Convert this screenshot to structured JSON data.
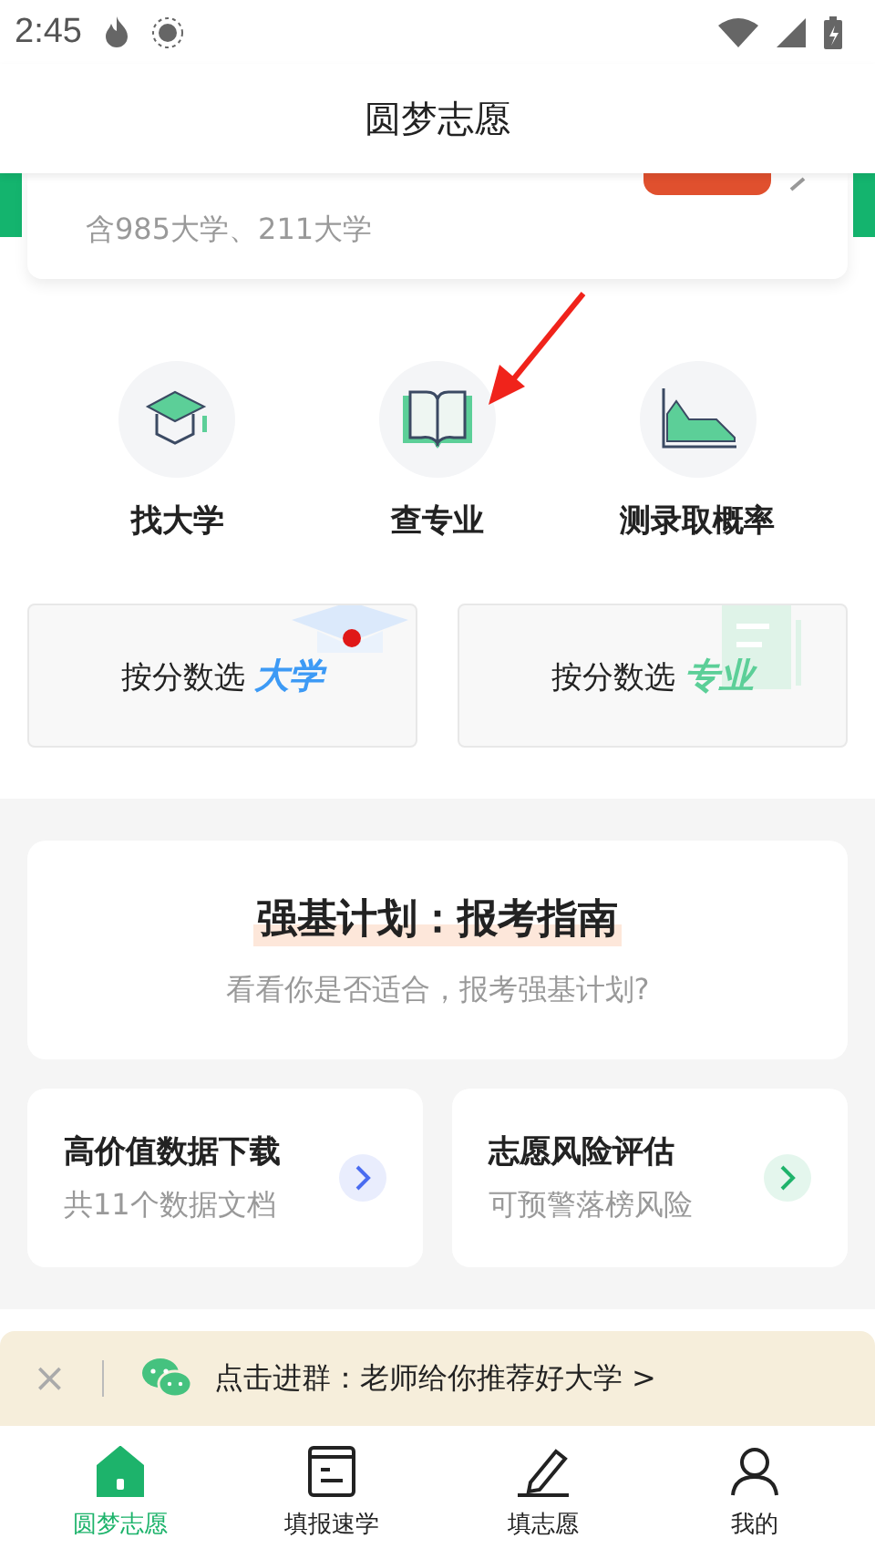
{
  "status_bar": {
    "time": "2:45"
  },
  "header": {
    "title": "圆梦志愿"
  },
  "top_card": {
    "subtitle": "含985大学、211大学"
  },
  "shortcuts": [
    {
      "kind": "cap",
      "label": "找大学"
    },
    {
      "kind": "book",
      "label": "查专业"
    },
    {
      "kind": "chart",
      "label": "测录取概率"
    }
  ],
  "score_buttons": [
    {
      "kind": "university",
      "prefix": "按分数选",
      "highlight": "大学",
      "dot": true
    },
    {
      "kind": "major",
      "prefix": "按分数选",
      "highlight": "专业",
      "dot": false
    }
  ],
  "feature_card": {
    "title": "强基计划：报考指南",
    "subtitle": "看看你是否适合，报考强基计划?"
  },
  "tiles": [
    {
      "title": "高价值数据下载",
      "subtitle": "共11个数据文档",
      "color": "#4a6cf0"
    },
    {
      "title": "志愿风险评估",
      "subtitle": "可预警落榜风险",
      "color": "#1fb36b"
    }
  ],
  "banner": {
    "close": "×",
    "text": "点击进群：老师给你推荐好大学 >"
  },
  "tabs": [
    {
      "kind": "home",
      "label": "圆梦志愿",
      "selected": true
    },
    {
      "kind": "guide",
      "label": "填报速学",
      "selected": false
    },
    {
      "kind": "pen",
      "label": "填志愿",
      "selected": false
    },
    {
      "kind": "user",
      "label": "我的",
      "selected": false
    }
  ]
}
